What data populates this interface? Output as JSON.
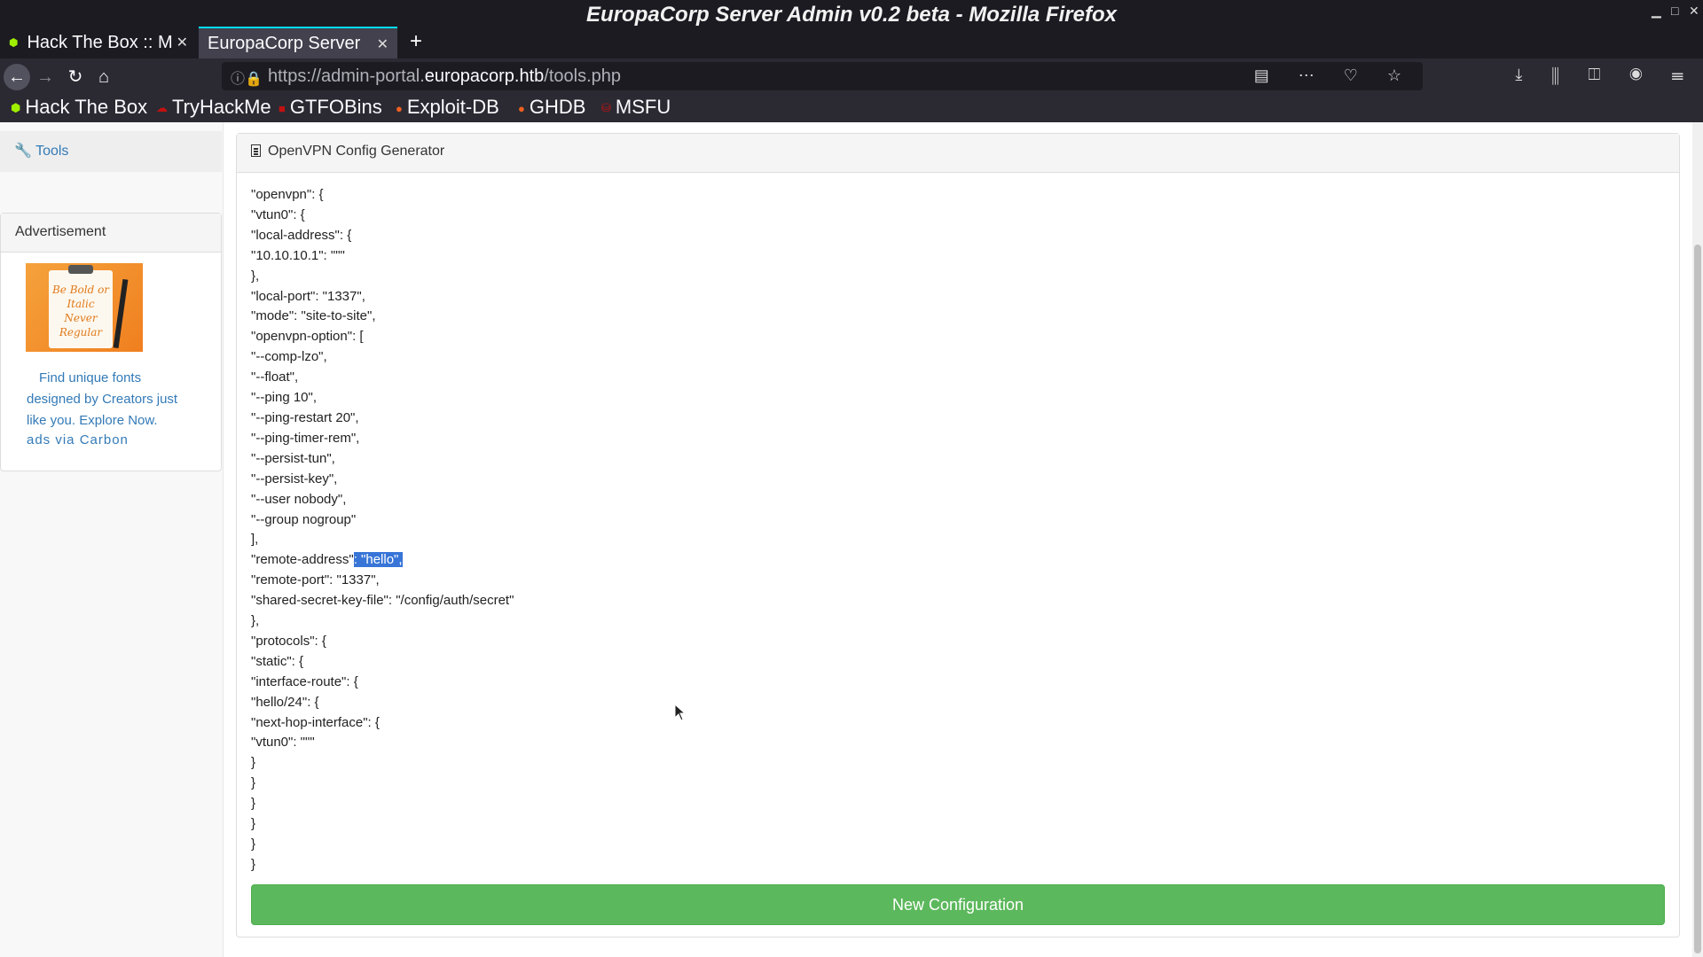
{
  "window": {
    "title": "EuropaCorp Server Admin v0.2 beta - Mozilla Firefox"
  },
  "tabs": [
    {
      "label": "Hack The Box :: M",
      "active": false
    },
    {
      "label": "EuropaCorp Server",
      "active": true
    }
  ],
  "new_tab_label": "+",
  "urlbar": {
    "url_prefix": "https://admin-portal.",
    "url_domain": "europacorp.htb",
    "url_path": "/tools.php"
  },
  "bookmarks": [
    "Hack The Box",
    "TryHackMe",
    "GTFOBins",
    "Exploit-DB",
    "GHDB",
    "MSFU"
  ],
  "sidebar": {
    "tools_label": "Tools",
    "ad_heading": "Advertisement",
    "ad_image_text": "Be Bold or Italic Never Regular",
    "ad_text": "Find unique fonts designed by Creators just like you. Explore Now.",
    "ad_via": "ads via Carbon"
  },
  "panel": {
    "heading": "OpenVPN Config Generator",
    "code_before": "\"openvpn\": {\n\"vtun0\": {\n\"local-address\": {\n\"10.10.10.1\": \"\"\"\n},\n\"local-port\": \"1337\",\n\"mode\": \"site-to-site\",\n\"openvpn-option\": [\n\"--comp-lzo\",\n\"--float\",\n\"--ping 10\",\n\"--ping-restart 20\",\n\"--ping-timer-rem\",\n\"--persist-tun\",\n\"--persist-key\",\n\"--user nobody\",\n\"--group nogroup\"\n],\n\"remote-address\"",
    "code_selected": ": \"hello\",",
    "code_after": "\n\"remote-port\": \"1337\",\n\"shared-secret-key-file\": \"/config/auth/secret\"\n},\n\"protocols\": {\n\"static\": {\n\"interface-route\": {\n\"hello/24\": {\n\"next-hop-interface\": {\n\"vtun0\": \"\"\"\n}\n}\n}\n}\n}\n}",
    "button_label": "New Configuration"
  },
  "colors": {
    "button_green": "#5cb85c",
    "link_blue": "#337ab7",
    "selection": "#3875d7"
  }
}
